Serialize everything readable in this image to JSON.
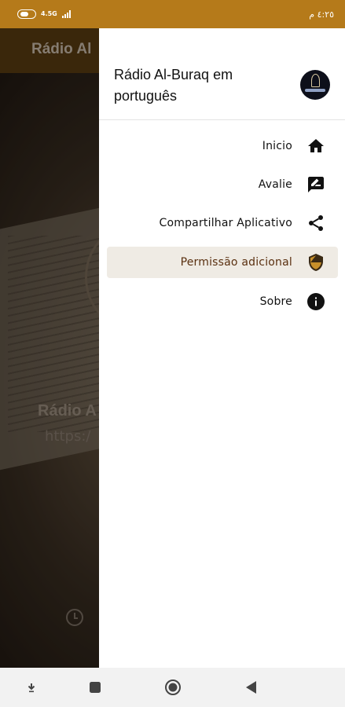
{
  "status_bar": {
    "network": "4.5G",
    "time": "٤:٢٥ م"
  },
  "app": {
    "title": "Rádio Al",
    "station_name": "Rádio A",
    "station_url": "https:/"
  },
  "drawer": {
    "title": "Rádio Al-Buraq em português",
    "logo_icon": "radio-station-logo",
    "items": [
      {
        "label": "Inicio",
        "icon": "home-icon",
        "active": false
      },
      {
        "label": "Avalie",
        "icon": "rate-feedback-icon",
        "active": false
      },
      {
        "label": "Compartilhar Aplicativo",
        "icon": "share-icon",
        "active": false
      },
      {
        "label": "Permissão adicional",
        "icon": "shield-icon",
        "active": true
      },
      {
        "label": "Sobre",
        "icon": "info-icon",
        "active": false
      }
    ]
  },
  "nav_bar": {
    "items": [
      "download-icon",
      "recents-square-icon",
      "home-circle-icon",
      "back-triangle-icon"
    ]
  },
  "colors": {
    "status_bar": "#b57a1a",
    "active_item_bg": "#efebe4",
    "shield_accent": "#c8902a"
  }
}
